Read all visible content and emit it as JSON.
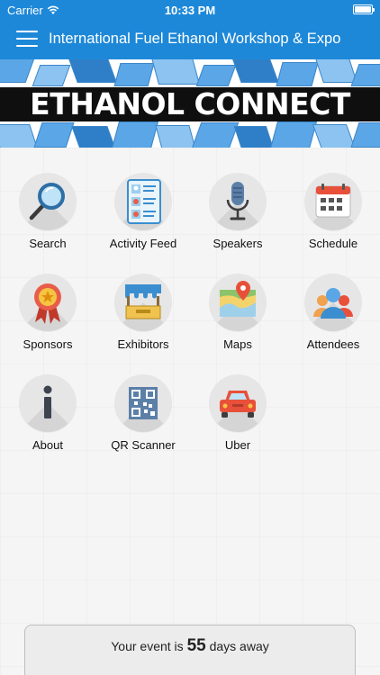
{
  "status": {
    "carrier": "Carrier",
    "time": "10:33 PM"
  },
  "nav": {
    "title": "International Fuel Ethanol Workshop & Expo"
  },
  "banner": {
    "text": "ETHANOL CONNECT"
  },
  "tiles": [
    {
      "label": "Search",
      "icon": "search-icon"
    },
    {
      "label": "Activity Feed",
      "icon": "activity-feed-icon"
    },
    {
      "label": "Speakers",
      "icon": "microphone-icon"
    },
    {
      "label": "Schedule",
      "icon": "calendar-icon"
    },
    {
      "label": "Sponsors",
      "icon": "award-ribbon-icon"
    },
    {
      "label": "Exhibitors",
      "icon": "booth-icon"
    },
    {
      "label": "Maps",
      "icon": "map-icon"
    },
    {
      "label": "Attendees",
      "icon": "people-icon"
    },
    {
      "label": "About",
      "icon": "info-icon"
    },
    {
      "label": "QR Scanner",
      "icon": "qr-code-icon"
    },
    {
      "label": "Uber",
      "icon": "car-icon"
    }
  ],
  "countdown": {
    "prefix": "Your event is",
    "days": "55",
    "suffix": "days away"
  },
  "colors": {
    "accent": "#1e88d8",
    "banner_bg": "#0f0f0f"
  }
}
